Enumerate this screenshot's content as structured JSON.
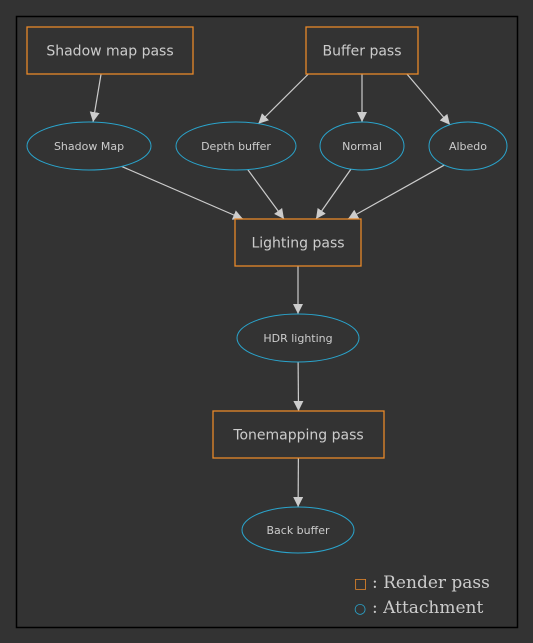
{
  "colors": {
    "background": "#333333",
    "render_pass": "#e8892a",
    "attachment": "#2aa4cc",
    "edge": "#cccccc",
    "text": "#cccccc",
    "frame": "#000000"
  },
  "nodes": {
    "shadow_map_pass": {
      "label": "Shadow map pass",
      "kind": "render-pass"
    },
    "buffer_pass": {
      "label": "Buffer pass",
      "kind": "render-pass"
    },
    "shadow_map": {
      "label": "Shadow Map",
      "kind": "attachment"
    },
    "depth_buffer": {
      "label": "Depth buffer",
      "kind": "attachment"
    },
    "normal": {
      "label": "Normal",
      "kind": "attachment"
    },
    "albedo": {
      "label": "Albedo",
      "kind": "attachment"
    },
    "lighting_pass": {
      "label": "Lighting pass",
      "kind": "render-pass"
    },
    "hdr_lighting": {
      "label": "HDR lighting",
      "kind": "attachment"
    },
    "tonemapping_pass": {
      "label": "Tonemapping pass",
      "kind": "render-pass"
    },
    "back_buffer": {
      "label": "Back buffer",
      "kind": "attachment"
    }
  },
  "edges": [
    [
      "shadow_map_pass",
      "shadow_map"
    ],
    [
      "buffer_pass",
      "depth_buffer"
    ],
    [
      "buffer_pass",
      "normal"
    ],
    [
      "buffer_pass",
      "albedo"
    ],
    [
      "shadow_map",
      "lighting_pass"
    ],
    [
      "depth_buffer",
      "lighting_pass"
    ],
    [
      "normal",
      "lighting_pass"
    ],
    [
      "albedo",
      "lighting_pass"
    ],
    [
      "lighting_pass",
      "hdr_lighting"
    ],
    [
      "hdr_lighting",
      "tonemapping_pass"
    ],
    [
      "tonemapping_pass",
      "back_buffer"
    ]
  ],
  "legend": {
    "render_pass_symbol": "□",
    "render_pass_label": ": Render pass",
    "attachment_symbol": "○",
    "attachment_label": ": Attachment"
  }
}
